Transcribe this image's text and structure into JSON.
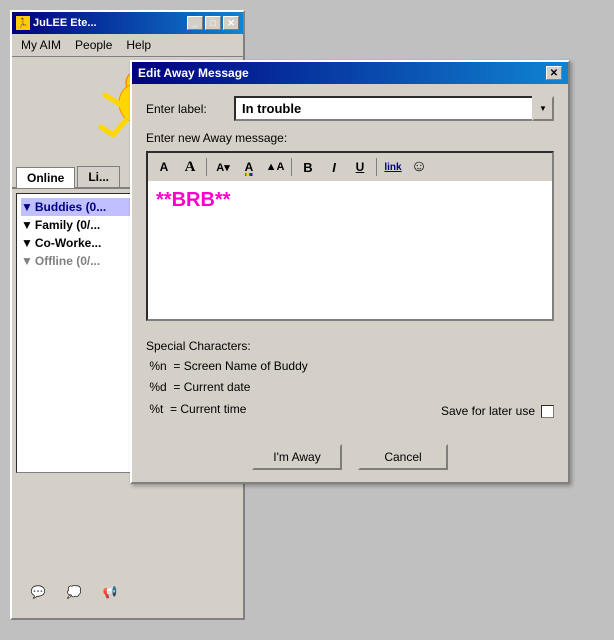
{
  "aim_window": {
    "title": "JuLEE Ete...",
    "menu": {
      "items": [
        "My AIM",
        "People",
        "Help"
      ]
    },
    "tabs": {
      "active": "Online",
      "inactive": "Li..."
    },
    "buddies": [
      {
        "label": "Buddies (0...",
        "active": true,
        "arrow": "▼"
      },
      {
        "label": "Family (0/...",
        "active": false,
        "arrow": "▼"
      },
      {
        "label": "Co-Worke...",
        "active": false,
        "arrow": "▼"
      },
      {
        "label": "Offline (0/...",
        "active": false,
        "arrow": "▼",
        "offline": true
      }
    ]
  },
  "dialog": {
    "title": "Edit Away Message",
    "close_label": "✕",
    "enter_label_label": "Enter label:",
    "label_value": "In trouble",
    "enter_msg_label": "Enter new Away message:",
    "message_text": "**BRB**",
    "toolbar": {
      "buttons": [
        {
          "id": "font-a",
          "label": "A",
          "style": "sans"
        },
        {
          "id": "font-a2",
          "label": "A",
          "style": "serif"
        },
        {
          "id": "font-smaller",
          "label": "A▾"
        },
        {
          "id": "font-color",
          "label": "A"
        },
        {
          "id": "font-bg",
          "label": "▲A"
        },
        {
          "id": "bold",
          "label": "B"
        },
        {
          "id": "italic",
          "label": "I"
        },
        {
          "id": "underline",
          "label": "U"
        },
        {
          "id": "link",
          "label": "link"
        },
        {
          "id": "emoji",
          "label": "☺"
        }
      ]
    },
    "special_chars": {
      "label": "Special Characters:",
      "items": [
        {
          "code": "%n",
          "desc": "= Screen Name of Buddy"
        },
        {
          "code": "%d",
          "desc": "= Current date"
        },
        {
          "code": "%t",
          "desc": "= Current time"
        }
      ]
    },
    "save_label": "Save for later use",
    "buttons": {
      "ok": "I'm Away",
      "cancel": "Cancel"
    }
  },
  "bottom_icons": {
    "icon1": "💬",
    "icon2": "💭",
    "icon3": "📢"
  }
}
